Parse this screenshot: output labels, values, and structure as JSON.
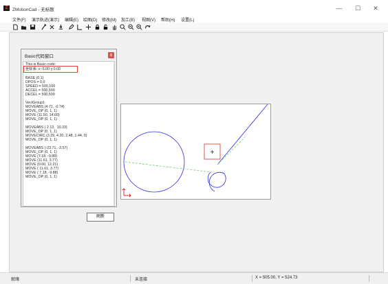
{
  "window": {
    "logo": "Z",
    "title": "ZMotionCad - 无标题",
    "controls": [
      "—",
      "☐",
      "✕"
    ]
  },
  "menu": [
    "文件(F)",
    "演示轨迹(演示)",
    "编辑(E)",
    "绘图(D)",
    "修改(M)",
    "加工(B)",
    "视图(V)",
    "帮助(H)",
    "设置(L)"
  ],
  "toolbar": {
    "icons": [
      "new-icon",
      "open-icon",
      "save-icon",
      "select-icon",
      "cut-icon",
      "download-icon",
      "pencil-icon",
      "line-icon",
      "crosshair-icon",
      "lock-icon",
      "unlock-icon",
      "pan-icon",
      "zoom-in-icon",
      "zoom-out-icon",
      "zoom-fit-icon",
      "redo-icon"
    ]
  },
  "basic_panel": {
    "title": "Basic代码窗口",
    "close": "x",
    "lines": [
      "This is Basic code:",
      "坐标系: x:-5.00 y:0.00",
      "",
      "BASE (0,1)",
      "DPOS = 0,0",
      "SPEED = 500,100",
      "ACCEL = 500,500",
      "DECEL = 500,500",
      "",
      "VectGroup1:",
      "MOVEABS (4.71, -0.74)",
      "MOVE_OP (0, 1, 1)",
      "MOVE (11.50, 14.60)",
      "MOVE_OP (0, 1, 1)",
      "",
      "MOVEABS ( 2.13,  10.33)",
      "MOVE_OP (0, 1, 1)",
      "MOVECIRC (3.29, 4.20, 2.48, 1.44, 0)",
      "MOVE_OP (0, 1, 1)",
      "",
      "MOVEABS (-23.71, -3.57)",
      "MOVE_OP (0, 1, 1)",
      "MOVE (7.18, -9.88)",
      "MOVE (11.61, 3.77)",
      "MOVE (0.00, 12.21)",
      "MOVE ( 11.61, 3.77)",
      "MOVE ( 7.18, -9.88)",
      "MOVE_OP (0, 1, 1)"
    ],
    "refresh_label": "刷新"
  },
  "canvas": {
    "cursor_marker": "+",
    "colors": {
      "path": "#2b2be8",
      "dashed_path": "#6ad06a",
      "axis": "#e02020",
      "highlight": "#e0433a"
    }
  },
  "status": {
    "left": "就绪",
    "middle": "未连接",
    "coords": "X = 505.00, Y = 524.73"
  }
}
